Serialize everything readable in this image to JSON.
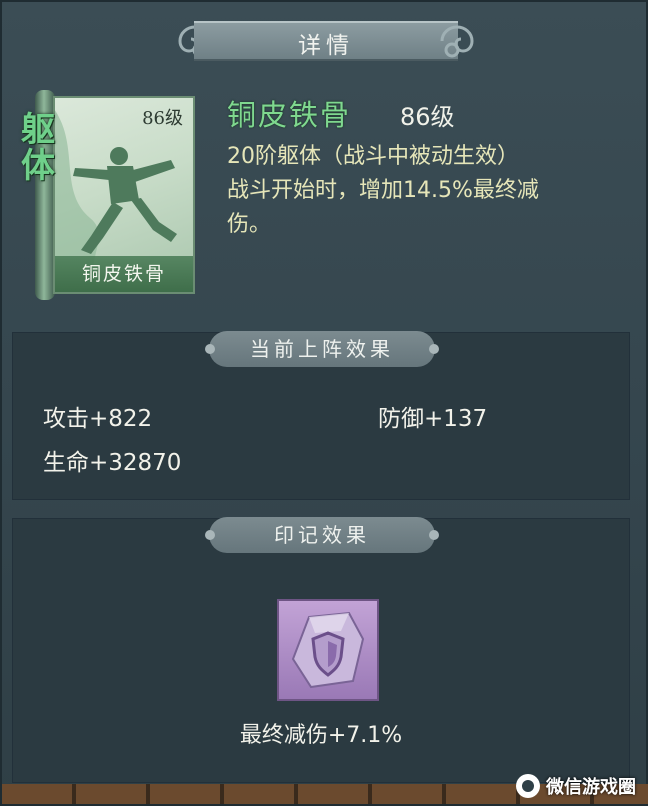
{
  "dialog": {
    "title": "详情"
  },
  "card": {
    "type_tag": "躯体",
    "level": "86级",
    "name": "铜皮铁骨"
  },
  "skill": {
    "name": "铜皮铁骨",
    "level": "86级",
    "rank_line": "20阶躯体（战斗中被动生效）",
    "desc_line1": "战斗开始时，增加14.5%最终减",
    "desc_line2": "伤。"
  },
  "battle_effects": {
    "title": "当前上阵效果",
    "attack": "攻击+822",
    "defense": "防御+137",
    "hp": "生命+32870"
  },
  "mark_effects": {
    "title": "印记效果",
    "icon": "shield-rune-stone-icon",
    "label": "最终减伤+7.1%"
  },
  "watermark": {
    "text": "微信游戏圈"
  },
  "colors": {
    "skill_name": "#7fd88f",
    "description": "#e6e6b9",
    "panel": "#34454d",
    "mark_icon": "#9a79b6"
  }
}
